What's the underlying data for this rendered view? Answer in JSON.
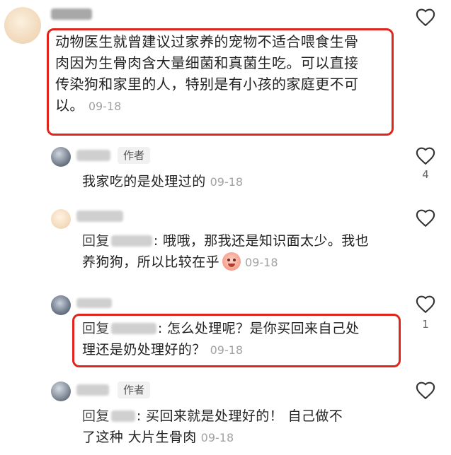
{
  "comments": [
    {
      "username": "",
      "text_lines": [
        "动物医生就曾建议过家养的宠物不适合喂食生骨",
        "肉因为生骨肉含大量细菌和真菌生吃。可以直接",
        "传染狗和家里的人，特别是有小孩的家庭更不可",
        "以。"
      ],
      "date": "09-18",
      "likes": ""
    }
  ],
  "replies": [
    {
      "author_tag": "作者",
      "text": "我家吃的是处理过的",
      "date": "09-18",
      "likes": "4"
    },
    {
      "reply_prefix": "回复",
      "text_lines": [
        ": 哦哦，那我还是知识面太少。我也",
        "养狗狗，所以比较在乎"
      ],
      "emoji": "flushed-face-icon",
      "date": "09-18",
      "likes": ""
    },
    {
      "reply_prefix": "回复",
      "text_lines": [
        ": 怎么处理呢？是你买回来自己处",
        "理还是奶处理好的？"
      ],
      "date": "09-18",
      "likes": "1"
    },
    {
      "author_tag": "作者",
      "reply_prefix": "回复",
      "text_lines": [
        ": 买回来就是处理好的！ 自己做不",
        "了这种 大片生骨肉"
      ],
      "date": "09-18",
      "likes": ""
    }
  ],
  "colors": {
    "highlight_border": "#e0251c",
    "date_gray": "#a2a2a2",
    "tag_background": "#f1f1f1"
  },
  "icons": {
    "like": "heart-outline-icon"
  }
}
